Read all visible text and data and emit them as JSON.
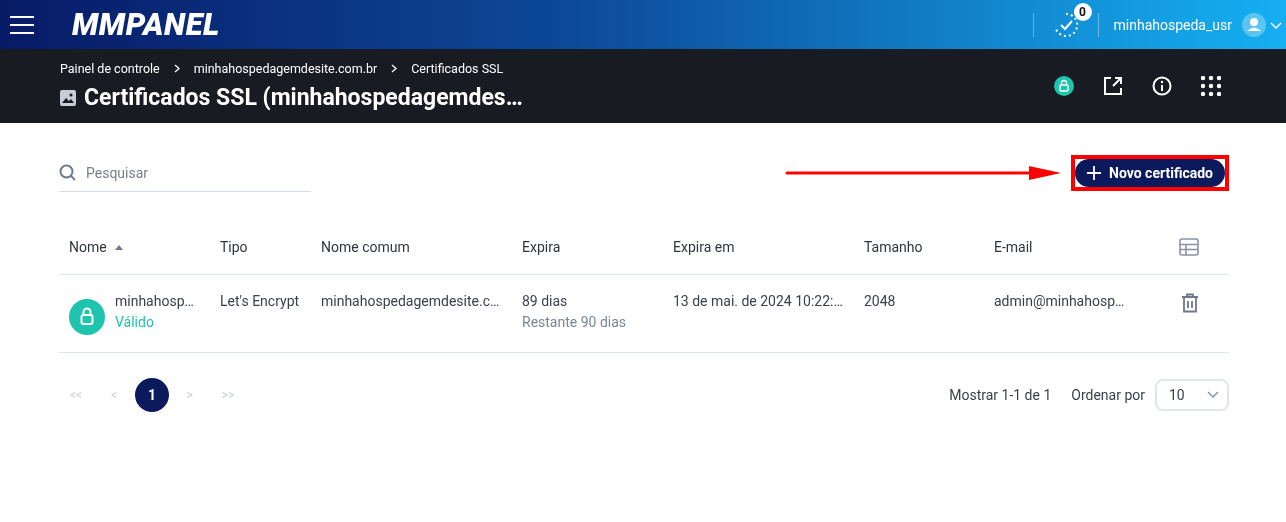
{
  "header": {
    "logo": "MMPANEL",
    "notifications_badge": "0",
    "username": "minhahospeda_usr"
  },
  "breadcrumbs": [
    "Painel de controle",
    "minhahospedagemdesite.com.br",
    "Certificados SSL"
  ],
  "page_title": "Certificados SSL (minhahospedagemdes…",
  "search": {
    "placeholder": "Pesquisar"
  },
  "new_button": {
    "label": "Novo certificado",
    "highlighted": true
  },
  "table": {
    "columns": [
      {
        "label": "Nome",
        "sorted": true
      },
      {
        "label": "Tipo",
        "sorted": false
      },
      {
        "label": "Nome comum",
        "sorted": false
      },
      {
        "label": "Expira",
        "sorted": false
      },
      {
        "label": "Expira em",
        "sorted": false
      },
      {
        "label": "Tamanho",
        "sorted": false
      },
      {
        "label": "E-mail",
        "sorted": false
      }
    ],
    "rows": [
      {
        "name": "minhahosp…",
        "status": "Válido",
        "type": "Let's Encrypt",
        "common_name": "minhahospedagemdesite.c…",
        "expires": "89 dias",
        "remaining": "Restante 90 dias",
        "expires_at": "13 de mai. de 2024 10:22:…",
        "size": "2048",
        "email": "admin@minhahosp…"
      }
    ]
  },
  "pagination": {
    "pages": [
      {
        "label": "<<",
        "selected": false,
        "disabled": true
      },
      {
        "label": "<",
        "selected": false,
        "disabled": true
      },
      {
        "label": "1",
        "selected": true,
        "disabled": false
      },
      {
        "label": ">",
        "selected": false,
        "disabled": true
      },
      {
        "label": ">>",
        "selected": false,
        "disabled": true
      }
    ],
    "summary": "Mostrar 1-1 de 1",
    "sort_label": "Ordenar por",
    "page_size": "10"
  }
}
